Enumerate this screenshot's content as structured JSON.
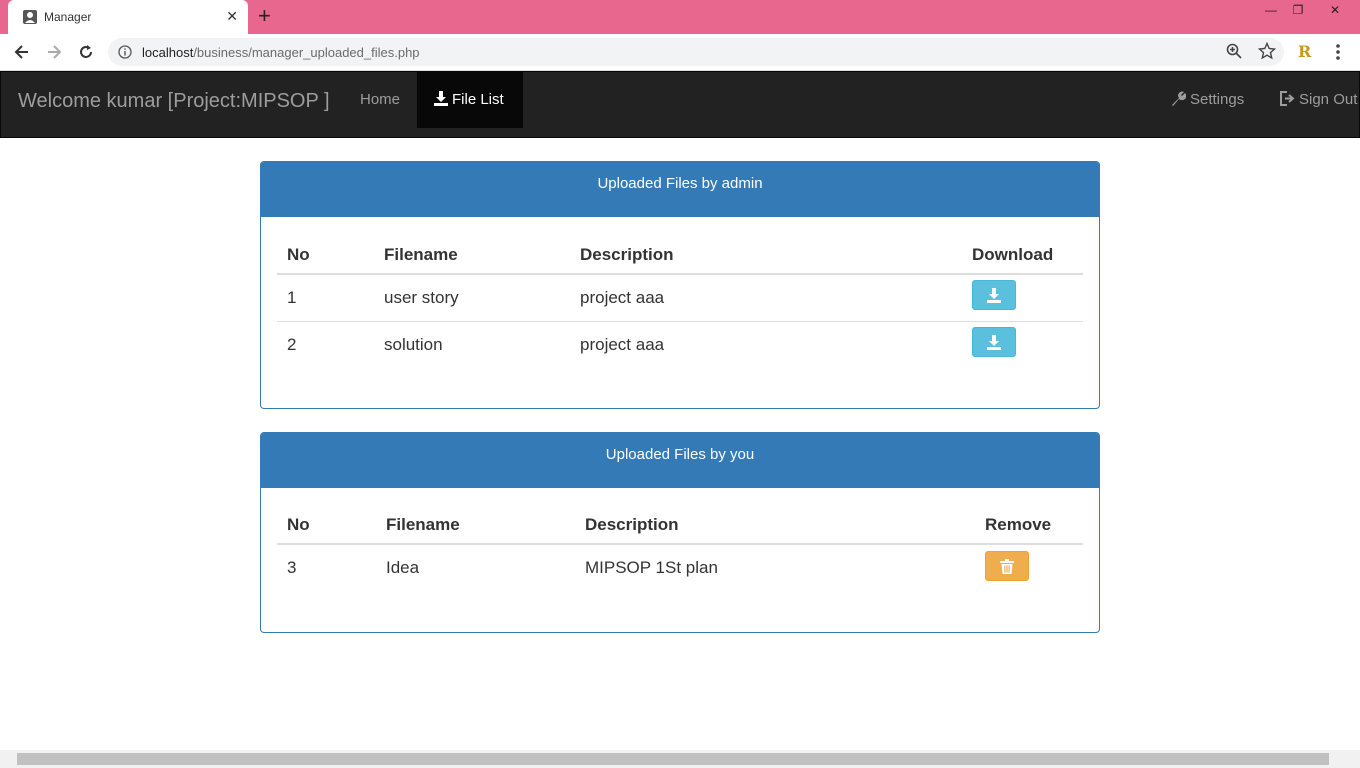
{
  "browser": {
    "tab_title": "Manager",
    "url_host": "localhost",
    "url_path": "/business/manager_uploaded_files.php",
    "ext_label": "R",
    "tab_close": "✕",
    "new_tab": "+",
    "win_minimize": "—",
    "win_restore": "❐",
    "win_close": "✕"
  },
  "navbar": {
    "brand": "Welcome kumar [Project:MIPSOP ]",
    "home": "Home",
    "file_list": "File List",
    "settings": "Settings",
    "sign_out": "Sign Out"
  },
  "admin_panel": {
    "heading": "Uploaded Files by admin",
    "columns": [
      "No",
      "Filename",
      "Description",
      "Download"
    ],
    "rows": [
      {
        "no": "1",
        "filename": "user story",
        "description": "project aaa"
      },
      {
        "no": "2",
        "filename": "solution",
        "description": "project aaa"
      }
    ]
  },
  "user_panel": {
    "heading": "Uploaded Files by you",
    "columns": [
      "No",
      "Filename",
      "Description",
      "Remove"
    ],
    "rows": [
      {
        "no": "3",
        "filename": "Idea",
        "description": "MIPSOP 1St plan"
      }
    ]
  },
  "colors": {
    "tabstrip": "#e8678f",
    "navbar": "#222222",
    "panel_primary": "#337ab7",
    "btn_info": "#5bc0de",
    "btn_warning": "#f0ad4e"
  }
}
